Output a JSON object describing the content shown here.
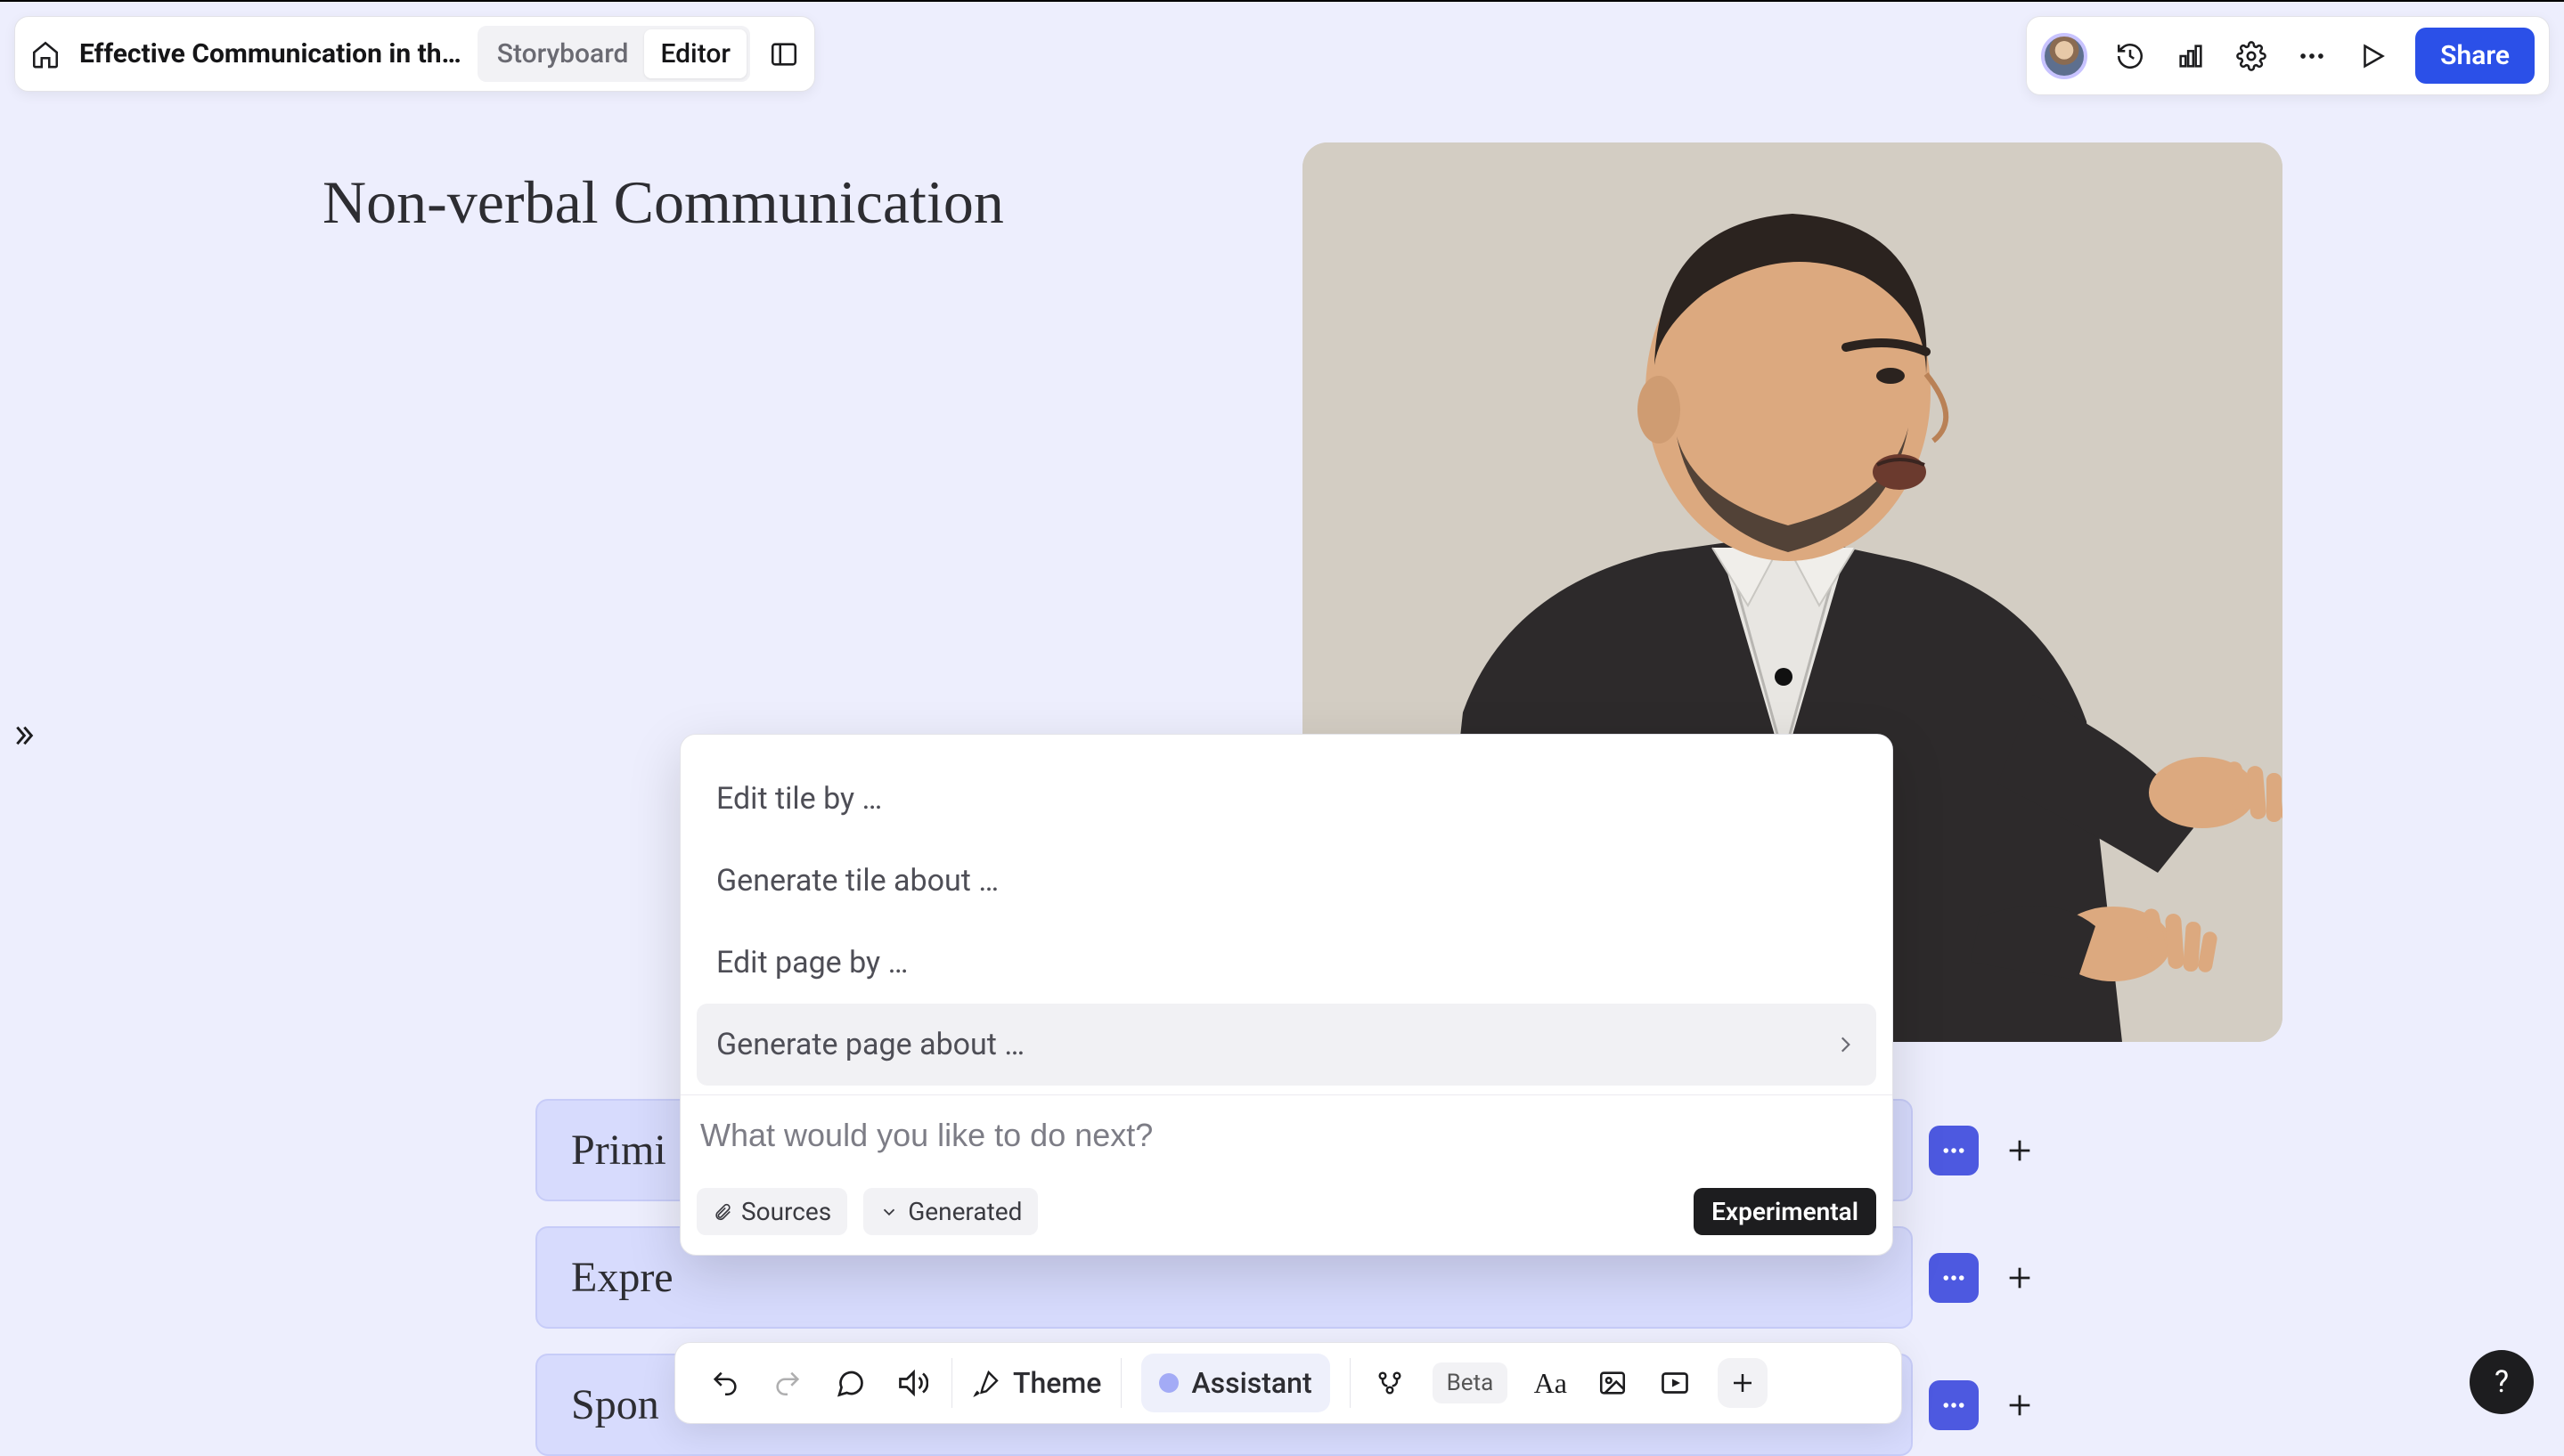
{
  "header": {
    "project_title": "Effective Communication in th…",
    "tabs": {
      "storyboard": "Storyboard",
      "editor": "Editor"
    },
    "active_tab": "editor",
    "share_label": "Share"
  },
  "canvas": {
    "page_title": "Non-verbal Communication",
    "hero_image_alt": "Man in suit speaking with open hand gestures",
    "accordion_items": [
      {
        "label": "Primi"
      },
      {
        "label": "Expre"
      },
      {
        "label": "Spon"
      }
    ]
  },
  "assistant": {
    "suggestions": [
      "Edit tile by …",
      "Generate tile about …",
      "Edit page by …",
      "Generate page about …"
    ],
    "hovered_index": 3,
    "input_placeholder": "What would you like to do next?",
    "sources_chip": "Sources",
    "generated_chip": "Generated",
    "experimental_badge": "Experimental"
  },
  "toolbar": {
    "theme_label": "Theme",
    "assistant_label": "Assistant",
    "beta_label": "Beta"
  },
  "help_label": "?",
  "icons": {
    "home": "home-icon",
    "panel": "panel-toggle-icon",
    "history": "history-icon",
    "chart": "bar-chart-icon",
    "settings": "gear-icon",
    "more": "more-icon",
    "play": "play-icon",
    "expand": "chevron-double-right-icon",
    "chevron_right": "chevron-right-icon",
    "attach": "paperclip-icon",
    "chevron_down": "chevron-down-icon",
    "undo": "undo-icon",
    "redo": "redo-icon",
    "comment": "comment-icon",
    "speaker": "speaker-icon",
    "brush": "brush-icon",
    "branch": "branch-icon",
    "text": "text-icon",
    "image": "image-icon",
    "video": "video-icon",
    "plus": "plus-icon"
  }
}
